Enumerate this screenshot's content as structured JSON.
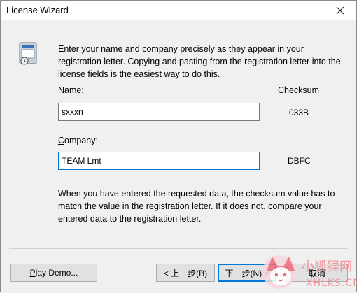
{
  "window": {
    "title": "License Wizard",
    "close_glyph": "✕"
  },
  "instructions": "Enter your name and company precisely as they appear in your registration letter.  Copying and pasting from the registration letter into the license fields is the easiest way to do this.",
  "fields": {
    "name_label": "Name:",
    "name_value": "sxxxn",
    "company_label": "Company:",
    "company_value": "TEAM Lmt",
    "checksum_label": "Checksum",
    "name_checksum": "033B",
    "company_checksum": "DBFC"
  },
  "note": "When you have entered the requested data, the checksum value has to match the value in the registration letter.  If it does not, compare your entered data to the registration letter.",
  "buttons": {
    "play_demo": "Play Demo...",
    "back": "< 上一步(B)",
    "next": "下一步(N) >",
    "cancel": "取消"
  },
  "watermark": {
    "title": "小狐狸网",
    "url": "XHLKS.CN"
  }
}
